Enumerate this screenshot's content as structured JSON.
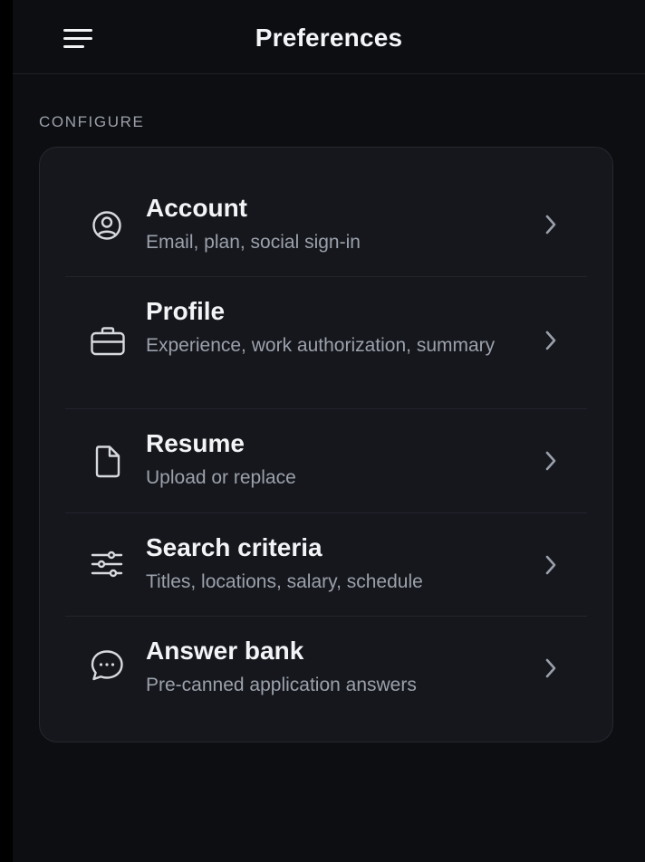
{
  "header": {
    "title": "Preferences",
    "menu_icon": "hamburger-menu-icon"
  },
  "section": {
    "label": "CONFIGURE"
  },
  "settings": {
    "items": [
      {
        "title": "Account",
        "subtitle": "Email, plan, social sign-in",
        "icon": "user-circle-icon"
      },
      {
        "title": "Profile",
        "subtitle": "Experience, work authorization, summary",
        "icon": "briefcase-icon"
      },
      {
        "title": "Resume",
        "subtitle": "Upload or replace",
        "icon": "document-icon"
      },
      {
        "title": "Search criteria",
        "subtitle": "Titles, locations, salary, schedule",
        "icon": "sliders-icon"
      },
      {
        "title": "Answer bank",
        "subtitle": "Pre-canned application answers",
        "icon": "chat-bubble-icon"
      }
    ]
  },
  "colors": {
    "background": "#0d0e11",
    "card": "#16171d",
    "text_primary": "#f3f4f6",
    "text_secondary": "#9ba1ab"
  }
}
